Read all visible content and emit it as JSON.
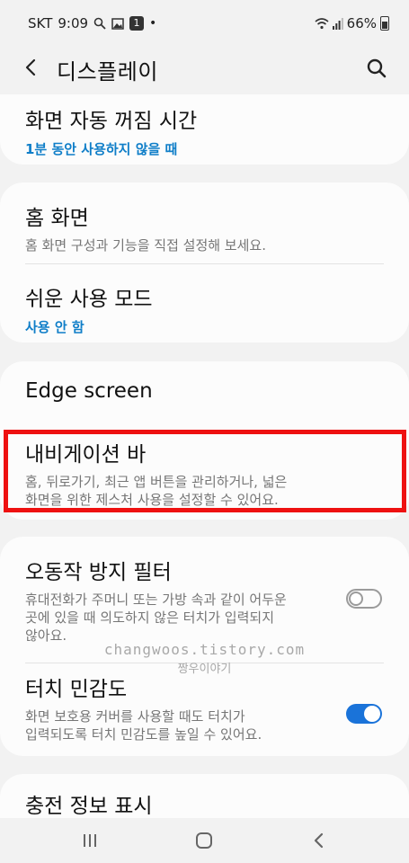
{
  "status": {
    "carrier": "SKT",
    "time": "9:09",
    "badge": "1",
    "dot": "•",
    "battery": "66%",
    "icons": [
      "search-icon",
      "image-icon",
      "notification-badge",
      "wifi-icon",
      "signal-icon",
      "battery-icon"
    ]
  },
  "appbar": {
    "title": "디스플레이",
    "icons": [
      "back-arrow-icon",
      "search-icon"
    ]
  },
  "items": {
    "screen_timeout": {
      "title": "화면 자동 꺼짐 시간",
      "sub": "1분 동안 사용하지 않을 때"
    },
    "home_screen": {
      "title": "홈 화면",
      "desc": "홈 화면 구성과 기능을 직접 설정해 보세요."
    },
    "easy_mode": {
      "title": "쉬운 사용 모드",
      "sub": "사용 안 함"
    },
    "edge_screen": {
      "title": "Edge screen"
    },
    "nav_bar": {
      "title": "내비게이션 바",
      "desc_1": "홈, 뒤로가기, 최근 앱 버튼을 관리하거나, 넓은",
      "desc_2": "화면을 위한 제스처 사용을 설정할 수 있어요."
    },
    "accidental_touch": {
      "title": "오동작 방지 필터",
      "desc_1": "휴대전화가 주머니 또는 가방 속과 같이 어두운",
      "desc_2": "곳에 있을 때 의도하지 않은 터치가 입력되지",
      "desc_3": "않아요.",
      "toggle": "off"
    },
    "touch_sensitivity": {
      "title": "터치 민감도",
      "desc_1": "화면 보호용 커버를 사용할 때도 터치가",
      "desc_2": "입력되도록 터치 민감도를 높일 수 있어요.",
      "toggle": "on"
    },
    "charging_info": {
      "title": "충전 정보 표시"
    }
  },
  "watermark": {
    "line1": "changwoos.tistory.com",
    "line2": "짱우이야기"
  },
  "colors": {
    "accent_blue": "#0f7ec8",
    "toggle_on": "#1a73d9",
    "highlight_red": "#ee1111"
  },
  "navbar": {
    "icons": [
      "recent-apps-icon",
      "home-icon",
      "back-icon"
    ]
  }
}
